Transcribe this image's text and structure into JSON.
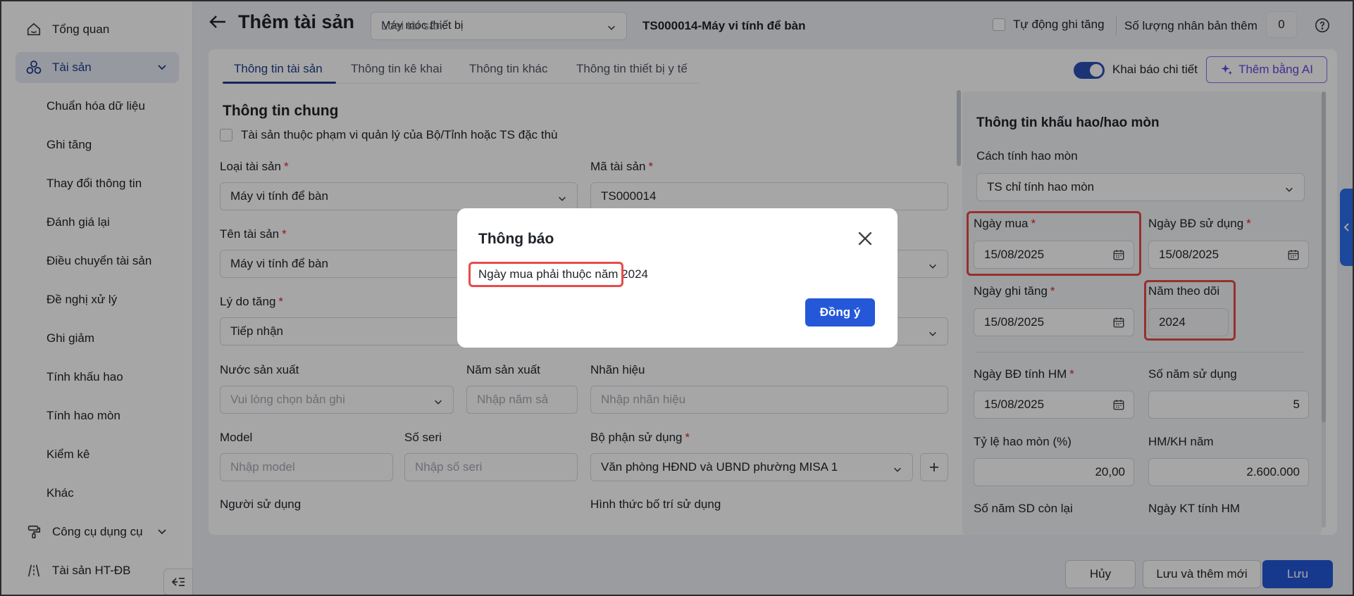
{
  "sidebar": {
    "overview": "Tổng quan",
    "assets": "Tài sản",
    "sub_items": [
      "Chuẩn hóa dữ liệu",
      "Ghi tăng",
      "Thay đổi thông tin",
      "Đánh giá lại",
      "Điều chuyển tài sản",
      "Đề nghị xử lý",
      "Ghi giảm",
      "Tính khấu hao",
      "Tính hao mòn",
      "Kiểm kê",
      "Khác"
    ],
    "tools": "Công cụ dụng cụ",
    "infra": "Tài sản HT-ĐB"
  },
  "header": {
    "title": "Thêm tài sản",
    "type_select_label": "Loại tài sản:",
    "type_select_value": "Máy móc thiết bị",
    "asset_code": "TS000014-Máy vi tính để bàn",
    "auto_increment_label": "Tự động ghi tăng",
    "duplicate_label": "Số lượng nhân bản thêm",
    "duplicate_value": "0"
  },
  "tabs": [
    "Thông tin tài sản",
    "Thông tin kê khai",
    "Thông tin khác",
    "Thông tin thiết bị y tế"
  ],
  "toggle_label": "Khai báo chi tiết",
  "ai_button": "Thêm bằng AI",
  "general": {
    "title": "Thông tin chung",
    "special_checkbox": "Tài sản thuộc phạm vi quản lý của Bộ/Tỉnh hoặc TS đặc thù",
    "asset_type_label": "Loại tài sản",
    "asset_type_value": "Máy vi tính để bàn",
    "asset_code_label": "Mã tài sản",
    "asset_code_value": "TS000014",
    "asset_name_label": "Tên tài sản",
    "asset_name_value": "Máy vi tính để bàn",
    "reason_label": "Lý do tăng",
    "reason_value": "Tiếp nhận",
    "country_label": "Nước sản xuất",
    "country_placeholder": "Vui lòng chọn bản ghi",
    "year_label": "Năm sản xuất",
    "year_placeholder": "Nhập năm sả",
    "brand_label": "Nhãn hiệu",
    "brand_placeholder": "Nhập nhãn hiệu",
    "model_label": "Model",
    "model_placeholder": "Nhập model",
    "serial_label": "Số seri",
    "serial_placeholder": "Nhập số seri",
    "dept_label": "Bộ phận sử dụng",
    "dept_value": "Văn phòng HĐND và UBND phường MISA 1",
    "user_label": "Người sử dụng",
    "usage_form_label": "Hình thức bố trí sử dụng"
  },
  "depreciation": {
    "title": "Thông tin khấu hao/hao mòn",
    "method_label": "Cách tính hao mòn",
    "method_value": "TS chỉ tính hao mòn",
    "purchase_date_label": "Ngày mua",
    "purchase_date_value": "15/08/2025",
    "start_use_label": "Ngày BĐ sử dụng",
    "start_use_value": "15/08/2025",
    "record_date_label": "Ngày ghi tăng",
    "record_date_value": "15/08/2025",
    "tracking_year_label": "Năm theo dõi",
    "tracking_year_value": "2024",
    "dep_start_label": "Ngày BĐ tính HM",
    "dep_start_value": "15/08/2025",
    "years_use_label": "Số năm sử dụng",
    "years_use_value": "5",
    "rate_label": "Tỷ lệ hao mòn (%)",
    "rate_value": "20,00",
    "annual_label": "HM/KH năm",
    "annual_value": "2.600.000",
    "remaining_label": "Số năm SD còn lại",
    "end_date_label": "Ngày KT tính HM"
  },
  "footer": {
    "cancel": "Hủy",
    "save_new": "Lưu và thêm mới",
    "save": "Lưu"
  },
  "modal": {
    "title": "Thông báo",
    "message": "Ngày mua phải thuộc năm 2024",
    "ok": "Đồng ý"
  },
  "colors": {
    "primary": "#2458d9",
    "active_nav": "#1f3d8a",
    "highlight": "#e84a4a",
    "ai_accent": "#6a44e0"
  }
}
